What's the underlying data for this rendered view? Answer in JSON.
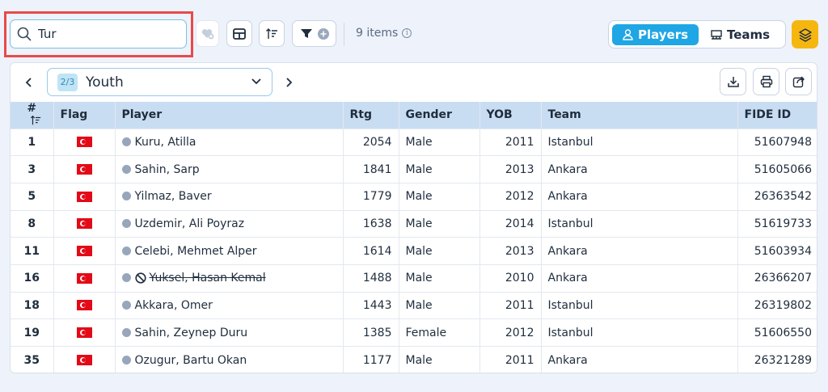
{
  "search": {
    "value": "Tur"
  },
  "toolbar": {
    "items_count": "9 items",
    "info": "i"
  },
  "view_toggle": {
    "players_label": "Players",
    "teams_label": "Teams"
  },
  "group": {
    "badge": "2/3",
    "label": "Youth"
  },
  "table": {
    "headers": {
      "no": "#",
      "flag": "Flag",
      "player": "Player",
      "rtg": "Rtg",
      "gender": "Gender",
      "yob": "YOB",
      "team": "Team",
      "fide": "FIDE ID"
    },
    "rows": [
      {
        "no": "1",
        "name": "Kuru, Atilla",
        "rtg": "2054",
        "gender": "Male",
        "yob": "2011",
        "team": "Istanbul",
        "fide": "51607948",
        "withdrawn": false
      },
      {
        "no": "3",
        "name": "Sahin, Sarp",
        "rtg": "1841",
        "gender": "Male",
        "yob": "2013",
        "team": "Ankara",
        "fide": "51605066",
        "withdrawn": false
      },
      {
        "no": "5",
        "name": "Yilmaz, Baver",
        "rtg": "1779",
        "gender": "Male",
        "yob": "2012",
        "team": "Ankara",
        "fide": "26363542",
        "withdrawn": false
      },
      {
        "no": "8",
        "name": "Uzdemir, Ali Poyraz",
        "rtg": "1638",
        "gender": "Male",
        "yob": "2014",
        "team": "Istanbul",
        "fide": "51619733",
        "withdrawn": false
      },
      {
        "no": "11",
        "name": "Celebi, Mehmet Alper",
        "rtg": "1614",
        "gender": "Male",
        "yob": "2013",
        "team": "Ankara",
        "fide": "51603934",
        "withdrawn": false
      },
      {
        "no": "16",
        "name": "Yuksel, Hasan Kemal",
        "rtg": "1488",
        "gender": "Male",
        "yob": "2010",
        "team": "Ankara",
        "fide": "26366207",
        "withdrawn": true
      },
      {
        "no": "18",
        "name": "Akkara, Omer",
        "rtg": "1443",
        "gender": "Male",
        "yob": "2011",
        "team": "Istanbul",
        "fide": "26319802",
        "withdrawn": false
      },
      {
        "no": "19",
        "name": "Sahin, Zeynep Duru",
        "rtg": "1385",
        "gender": "Female",
        "yob": "2012",
        "team": "Istanbul",
        "fide": "51606550",
        "withdrawn": false
      },
      {
        "no": "35",
        "name": "Ozugur, Bartu Okan",
        "rtg": "1177",
        "gender": "Male",
        "yob": "2011",
        "team": "Ankara",
        "fide": "26321289",
        "withdrawn": false
      }
    ]
  },
  "colors": {
    "accent": "#1fa6e4",
    "header_bg": "#c9ddf2",
    "layers": "#f5b70f",
    "highlight": "#e84a4a"
  }
}
